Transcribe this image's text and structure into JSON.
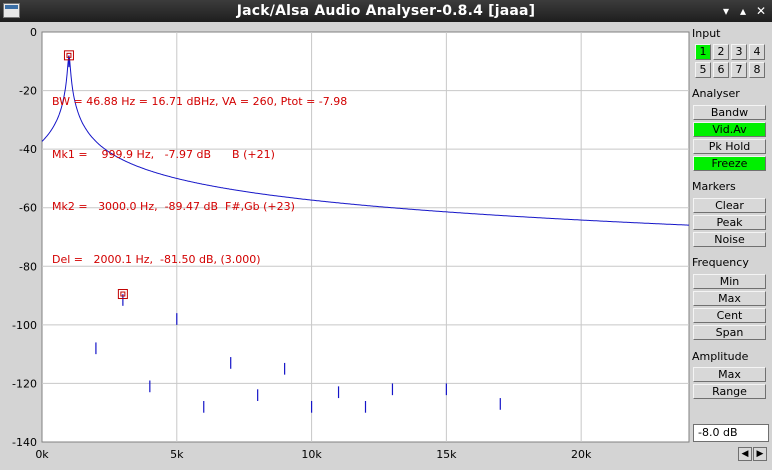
{
  "window": {
    "title": "Jack/Alsa Audio Analyser-0.8.4  [jaaa]",
    "controls": {
      "minimize": "▾",
      "maximize": "▴",
      "close": "✕"
    }
  },
  "readout": {
    "line1": "BW = 46.88 Hz = 16.71 dBHz, VA = 260, Ptot = -7.98",
    "line2": "Mk1 =    999.9 Hz,   -7.97 dB      B (+21)",
    "line3": "Mk2 =   3000.0 Hz,  -89.47 dB  F#,Gb (+23)",
    "line4": "Del =   2000.1 Hz,  -81.50 dB, (3.000)"
  },
  "chart_data": {
    "type": "line",
    "xlabel": "",
    "ylabel": "",
    "xlim": [
      0,
      24000
    ],
    "ylim": [
      -140,
      0
    ],
    "x_ticks": [
      "0k",
      "5k",
      "10k",
      "15k",
      "20k"
    ],
    "x_tick_values": [
      0,
      5000,
      10000,
      15000,
      20000
    ],
    "y_ticks": [
      "0",
      "-20",
      "-40",
      "-60",
      "-80",
      "-100",
      "-120",
      "-140"
    ],
    "y_tick_values": [
      0,
      -20,
      -40,
      -60,
      -80,
      -100,
      -120,
      -140
    ],
    "grid": true,
    "line_color": "#1515c8",
    "noise_floor_db": -129,
    "peaks": [
      {
        "freq": 1000,
        "db": -8
      },
      {
        "freq": 2000,
        "db": -106
      },
      {
        "freq": 3000,
        "db": -89.5
      },
      {
        "freq": 4000,
        "db": -119
      },
      {
        "freq": 5000,
        "db": -96
      },
      {
        "freq": 6000,
        "db": -126
      },
      {
        "freq": 7000,
        "db": -111
      },
      {
        "freq": 8000,
        "db": -122
      },
      {
        "freq": 9000,
        "db": -113
      },
      {
        "freq": 10000,
        "db": -126
      },
      {
        "freq": 11000,
        "db": -121
      },
      {
        "freq": 12000,
        "db": -126
      },
      {
        "freq": 13000,
        "db": -120
      },
      {
        "freq": 15000,
        "db": -120
      },
      {
        "freq": 17000,
        "db": -125
      }
    ],
    "markers": [
      {
        "freq": 1000,
        "db": -7.97
      },
      {
        "freq": 3000,
        "db": -89.47
      }
    ]
  },
  "panel": {
    "input_label": "Input",
    "channels": [
      "1",
      "2",
      "3",
      "4",
      "5",
      "6",
      "7",
      "8"
    ],
    "active_channel": "1",
    "analyser_label": "Analyser",
    "analyser_buttons": [
      "Bandw",
      "Vid.Av",
      "Pk Hold",
      "Freeze"
    ],
    "markers_label": "Markers",
    "markers_buttons": [
      "Clear",
      "Peak",
      "Noise"
    ],
    "frequency_label": "Frequency",
    "frequency_buttons": [
      "Min",
      "Max",
      "Cent",
      "Span"
    ],
    "amplitude_label": "Amplitude",
    "amplitude_buttons": [
      "Max",
      "Range"
    ],
    "level_value": "-8.0 dB",
    "scroll_left": "◀",
    "scroll_right": "▶"
  },
  "colors": {
    "active_button": "#00f000",
    "readout_text": "#d20000",
    "marker": "#c00000"
  }
}
